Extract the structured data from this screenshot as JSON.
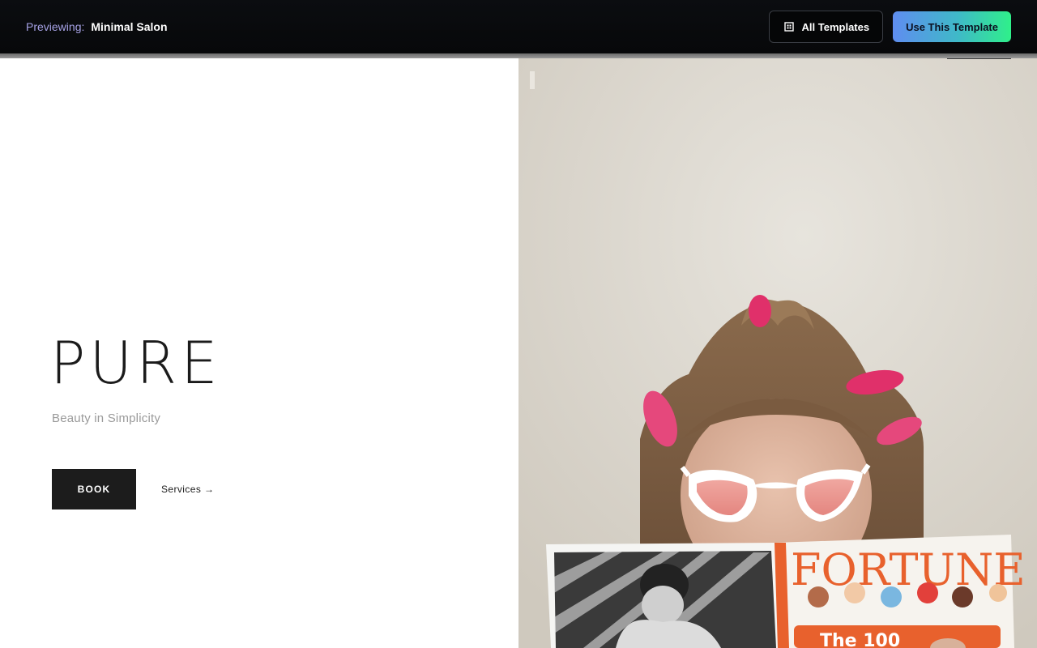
{
  "preview": {
    "prefix": "Previewing:",
    "template_name": "Minimal Salon"
  },
  "toolbar": {
    "all_templates_label": "All Templates",
    "use_template_label": "Use This Template"
  },
  "hero": {
    "title": "PURE",
    "subtitle": "Beauty in Simplicity",
    "book_label": "BOOK",
    "services_label": "Services →"
  },
  "image": {
    "magazine_title": "FORTUNE",
    "magazine_cover_line": "The 100"
  },
  "colors": {
    "topbar_bg": "#07080a",
    "preview_prefix": "#a6a2e6",
    "cta_gradient_start": "#5f8df0",
    "cta_gradient_end": "#2ff08a",
    "book_bg": "#1c1c1c"
  },
  "icons": {
    "all_templates_icon": "grid-icon"
  }
}
